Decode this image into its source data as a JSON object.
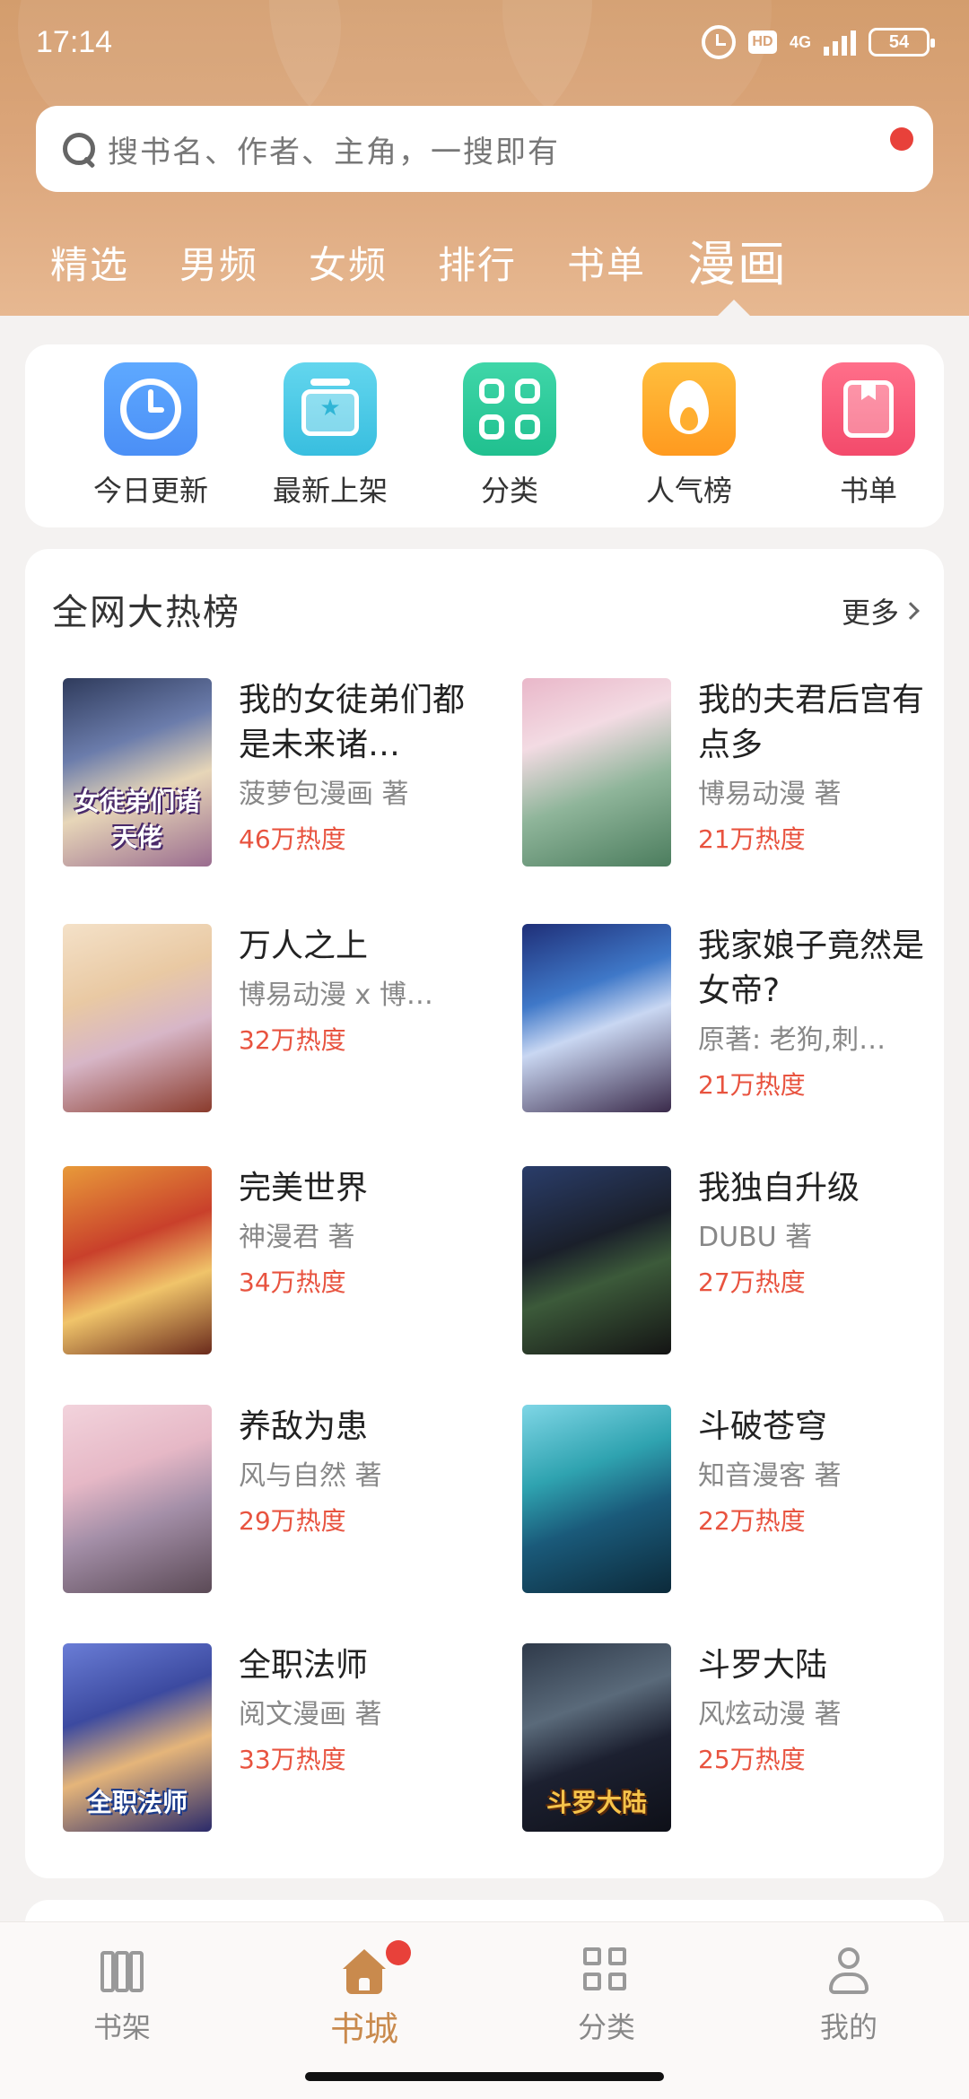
{
  "status_bar": {
    "time": "17:14",
    "hd": "HD",
    "network": "4G",
    "battery": "54"
  },
  "search": {
    "placeholder": "搜书名、作者、主角，一搜即有"
  },
  "tabs": [
    {
      "label": "精选"
    },
    {
      "label": "男频"
    },
    {
      "label": "女频"
    },
    {
      "label": "排行"
    },
    {
      "label": "书单"
    },
    {
      "label": "漫画",
      "active": true
    }
  ],
  "quick_nav": [
    {
      "label": "今日更新",
      "icon": "clock-icon"
    },
    {
      "label": "最新上架",
      "icon": "new-arrival-icon"
    },
    {
      "label": "分类",
      "icon": "category-icon"
    },
    {
      "label": "人气榜",
      "icon": "flame-icon"
    },
    {
      "label": "书单",
      "icon": "booklist-icon"
    }
  ],
  "hot_list": {
    "title": "全网大热榜",
    "more": "更多",
    "books": [
      {
        "title": "我的女徒弟们都是未来诸…",
        "author": "菠萝包漫画 著",
        "heat": "46万热度",
        "cover_text": "女徒弟们诸天佬"
      },
      {
        "title": "我的夫君后宫有点多",
        "author": "博易动漫 著",
        "heat": "21万热度",
        "cover_text": ""
      },
      {
        "title": "万人之上",
        "author": "博易动漫 x 博…",
        "heat": "32万热度",
        "cover_text": ""
      },
      {
        "title": "我家娘子竟然是女帝?",
        "author": "原著: 老狗,刺…",
        "heat": "21万热度",
        "cover_text": ""
      },
      {
        "title": "完美世界",
        "author": "神漫君 著",
        "heat": "34万热度",
        "cover_text": ""
      },
      {
        "title": "我独自升级",
        "author": "DUBU 著",
        "heat": "27万热度",
        "cover_text": ""
      },
      {
        "title": "养敌为患",
        "author": "风与自然 著",
        "heat": "29万热度",
        "cover_text": ""
      },
      {
        "title": "斗破苍穹",
        "author": "知音漫客 著",
        "heat": "22万热度",
        "cover_text": ""
      },
      {
        "title": "全职法师",
        "author": "阅文漫画 著",
        "heat": "33万热度",
        "cover_text": "全职法师"
      },
      {
        "title": "斗罗大陆",
        "author": "风炫动漫 著",
        "heat": "25万热度",
        "cover_text": "斗罗大陆"
      }
    ]
  },
  "bottom_nav": [
    {
      "label": "书架",
      "icon": "bookshelf-icon"
    },
    {
      "label": "书城",
      "icon": "home-icon",
      "active": true
    },
    {
      "label": "分类",
      "icon": "category-grid-icon"
    },
    {
      "label": "我的",
      "icon": "profile-icon"
    }
  ],
  "colors": {
    "accent": "#c98a4d",
    "heat": "#e8533f",
    "badge": "#e8413a"
  }
}
